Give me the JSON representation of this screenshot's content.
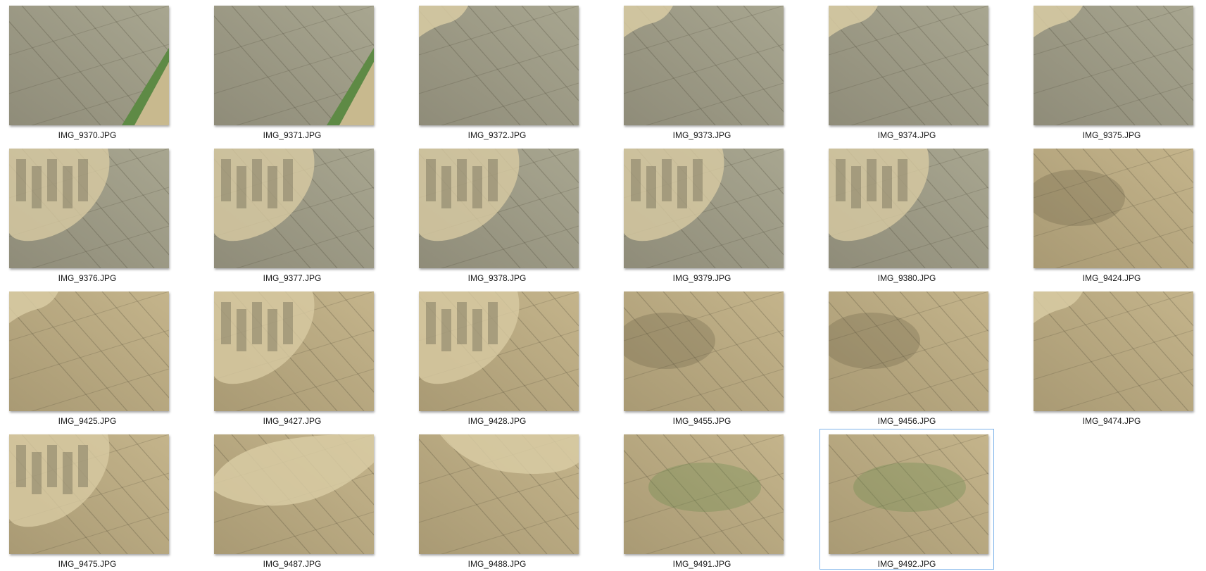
{
  "files": [
    {
      "name": "IMG_9370.JPG",
      "tone": "gray",
      "feature": "road"
    },
    {
      "name": "IMG_9371.JPG",
      "tone": "gray",
      "feature": "road"
    },
    {
      "name": "IMG_9372.JPG",
      "tone": "gray",
      "feature": "corner"
    },
    {
      "name": "IMG_9373.JPG",
      "tone": "gray",
      "feature": "corner"
    },
    {
      "name": "IMG_9374.JPG",
      "tone": "gray",
      "feature": "corner"
    },
    {
      "name": "IMG_9375.JPG",
      "tone": "gray",
      "feature": "corner"
    },
    {
      "name": "IMG_9376.JPG",
      "tone": "gray",
      "feature": "site"
    },
    {
      "name": "IMG_9377.JPG",
      "tone": "gray",
      "feature": "site"
    },
    {
      "name": "IMG_9378.JPG",
      "tone": "gray",
      "feature": "site"
    },
    {
      "name": "IMG_9379.JPG",
      "tone": "gray",
      "feature": "site"
    },
    {
      "name": "IMG_9380.JPG",
      "tone": "gray",
      "feature": "site"
    },
    {
      "name": "IMG_9424.JPG",
      "tone": "tan",
      "feature": "plain"
    },
    {
      "name": "IMG_9425.JPG",
      "tone": "tan",
      "feature": "corner"
    },
    {
      "name": "IMG_9427.JPG",
      "tone": "tan",
      "feature": "site"
    },
    {
      "name": "IMG_9428.JPG",
      "tone": "tan",
      "feature": "site"
    },
    {
      "name": "IMG_9455.JPG",
      "tone": "tan",
      "feature": "plain"
    },
    {
      "name": "IMG_9456.JPG",
      "tone": "tan",
      "feature": "plain"
    },
    {
      "name": "IMG_9474.JPG",
      "tone": "tan",
      "feature": "corner"
    },
    {
      "name": "IMG_9475.JPG",
      "tone": "tan",
      "feature": "site"
    },
    {
      "name": "IMG_9487.JPG",
      "tone": "tan",
      "feature": "swirl"
    },
    {
      "name": "IMG_9488.JPG",
      "tone": "tan",
      "feature": "arc"
    },
    {
      "name": "IMG_9491.JPG",
      "tone": "tan",
      "feature": "green"
    },
    {
      "name": "IMG_9492.JPG",
      "tone": "tan",
      "feature": "green",
      "selected": true
    }
  ],
  "colors": {
    "gray_field": "#8f8c79",
    "tan_field": "#a99a74",
    "light_soil": "#d8cba3",
    "road_green": "#5e8a45",
    "selection_border": "#7eb4ea"
  }
}
